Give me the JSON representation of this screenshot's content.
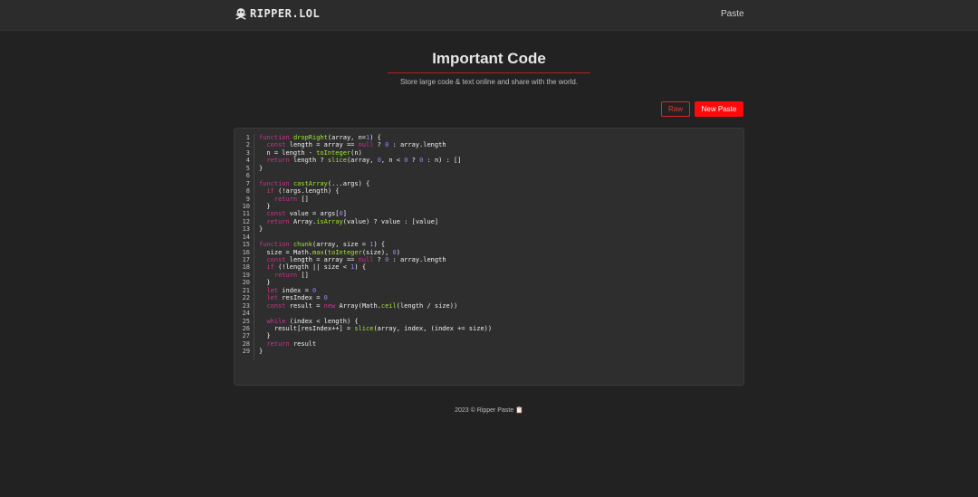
{
  "nav": {
    "brand": "RIPPER.LOL",
    "brand_icon": "skull-crossbones-icon",
    "link": "Paste"
  },
  "header": {
    "title": "Important Code",
    "subtitle": "Store large code & text online and share with the world."
  },
  "actions": {
    "raw": "Raw",
    "new_paste": "New Paste"
  },
  "code": {
    "lines": [
      [
        [
          "kw",
          "function "
        ],
        [
          "fn",
          "dropRight"
        ],
        [
          "t",
          "(array, n="
        ],
        [
          "num",
          "1"
        ],
        [
          "t",
          ") {"
        ]
      ],
      [
        [
          "t",
          "  "
        ],
        [
          "kw",
          "const "
        ],
        [
          "t",
          "length = array == "
        ],
        [
          "kw",
          "null"
        ],
        [
          "t",
          " ? "
        ],
        [
          "num",
          "0"
        ],
        [
          "t",
          " : array.length"
        ]
      ],
      [
        [
          "t",
          "  n = length - "
        ],
        [
          "fn",
          "toInteger"
        ],
        [
          "t",
          "(n)"
        ]
      ],
      [
        [
          "t",
          "  "
        ],
        [
          "kw",
          "return "
        ],
        [
          "t",
          "length ? "
        ],
        [
          "fn",
          "slice"
        ],
        [
          "t",
          "(array, "
        ],
        [
          "num",
          "0"
        ],
        [
          "t",
          ", n < "
        ],
        [
          "num",
          "0"
        ],
        [
          "t",
          " ? "
        ],
        [
          "num",
          "0"
        ],
        [
          "t",
          " : n) : []"
        ]
      ],
      [
        [
          "t",
          "}"
        ]
      ],
      [
        [
          "t",
          ""
        ]
      ],
      [
        [
          "kw",
          "function "
        ],
        [
          "fn",
          "castArray"
        ],
        [
          "t",
          "(...args) {"
        ]
      ],
      [
        [
          "t",
          "  "
        ],
        [
          "kw",
          "if "
        ],
        [
          "t",
          "(!args.length) {"
        ]
      ],
      [
        [
          "t",
          "    "
        ],
        [
          "kw",
          "return "
        ],
        [
          "t",
          "[]"
        ]
      ],
      [
        [
          "t",
          "  }"
        ]
      ],
      [
        [
          "t",
          "  "
        ],
        [
          "kw",
          "const "
        ],
        [
          "t",
          "value = args["
        ],
        [
          "num",
          "0"
        ],
        [
          "t",
          "]"
        ]
      ],
      [
        [
          "t",
          "  "
        ],
        [
          "kw",
          "return "
        ],
        [
          "t",
          "Array."
        ],
        [
          "fn",
          "isArray"
        ],
        [
          "t",
          "(value) ? value : [value]"
        ]
      ],
      [
        [
          "t",
          "}"
        ]
      ],
      [
        [
          "t",
          ""
        ]
      ],
      [
        [
          "kw",
          "function "
        ],
        [
          "fn",
          "chunk"
        ],
        [
          "t",
          "(array, size = "
        ],
        [
          "num",
          "1"
        ],
        [
          "t",
          ") {"
        ]
      ],
      [
        [
          "t",
          "  size = Math."
        ],
        [
          "fn",
          "max"
        ],
        [
          "t",
          "("
        ],
        [
          "fn",
          "toInteger"
        ],
        [
          "t",
          "(size), "
        ],
        [
          "num",
          "0"
        ],
        [
          "t",
          ")"
        ]
      ],
      [
        [
          "t",
          "  "
        ],
        [
          "kw",
          "const "
        ],
        [
          "t",
          "length = array == "
        ],
        [
          "kw",
          "null"
        ],
        [
          "t",
          " ? "
        ],
        [
          "num",
          "0"
        ],
        [
          "t",
          " : array.length"
        ]
      ],
      [
        [
          "t",
          "  "
        ],
        [
          "kw",
          "if "
        ],
        [
          "t",
          "(!length || size < "
        ],
        [
          "num",
          "1"
        ],
        [
          "t",
          ") {"
        ]
      ],
      [
        [
          "t",
          "    "
        ],
        [
          "kw",
          "return "
        ],
        [
          "t",
          "[]"
        ]
      ],
      [
        [
          "t",
          "  }"
        ]
      ],
      [
        [
          "t",
          "  "
        ],
        [
          "kw",
          "let "
        ],
        [
          "t",
          "index = "
        ],
        [
          "num",
          "0"
        ]
      ],
      [
        [
          "t",
          "  "
        ],
        [
          "kw",
          "let "
        ],
        [
          "t",
          "resIndex = "
        ],
        [
          "num",
          "0"
        ]
      ],
      [
        [
          "t",
          "  "
        ],
        [
          "kw",
          "const "
        ],
        [
          "t",
          "result = "
        ],
        [
          "kw",
          "new "
        ],
        [
          "t",
          "Array(Math."
        ],
        [
          "fn",
          "ceil"
        ],
        [
          "t",
          "(length / size))"
        ]
      ],
      [
        [
          "t",
          ""
        ]
      ],
      [
        [
          "t",
          "  "
        ],
        [
          "kw",
          "while "
        ],
        [
          "t",
          "(index < length) {"
        ]
      ],
      [
        [
          "t",
          "    result[resIndex++] = "
        ],
        [
          "fn",
          "slice"
        ],
        [
          "t",
          "(array, index, (index += size))"
        ]
      ],
      [
        [
          "t",
          "  }"
        ]
      ],
      [
        [
          "t",
          "  "
        ],
        [
          "kw",
          "return "
        ],
        [
          "t",
          "result"
        ]
      ],
      [
        [
          "t",
          "}"
        ]
      ]
    ]
  },
  "footer": {
    "text": "2023 © Ripper Paste 📋"
  },
  "colors": {
    "accent": "#ff0a0a",
    "keyword": "#d0308f",
    "function": "#9ee82b",
    "number": "#9a82ff"
  }
}
